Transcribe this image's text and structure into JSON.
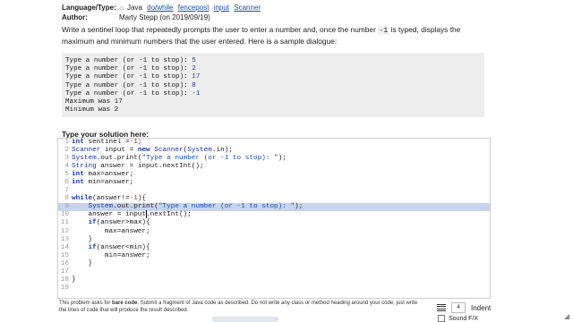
{
  "meta": {
    "language_label": "Language/Type:",
    "language_icon": "java-cup-icon",
    "language_value": "Java",
    "tags": [
      "do/while",
      "fencepost",
      "input",
      "Scanner"
    ],
    "author_label": "Author:",
    "author_value": "Marty Stepp (on 2019/09/19)"
  },
  "description": {
    "before_code": "Write a sentinel loop that repeatedly prompts the user to enter a number and, once the number ",
    "code": "-1",
    "after_code": " is typed, displays the maximum and minimum numbers that the user entered. Here is a sample dialogue:"
  },
  "sample": {
    "lines": [
      {
        "prompt": "Type a number (or -1 to stop): ",
        "input": "5"
      },
      {
        "prompt": "Type a number (or -1 to stop): ",
        "input": "2"
      },
      {
        "prompt": "Type a number (or -1 to stop): ",
        "input": "17"
      },
      {
        "prompt": "Type a number (or -1 to stop): ",
        "input": "8"
      },
      {
        "prompt": "Type a number (or -1 to stop): ",
        "input": "-1"
      }
    ],
    "output": [
      "Maximum was 17",
      "Minimum was 2"
    ]
  },
  "solution_label": "Type your solution here:",
  "editor": {
    "lines": [
      "int sentinel =-1;",
      "Scanner input = new Scanner(System.in);",
      "System.out.print(\"Type a number (or -1 to stop): \");",
      "String answer = input.nextInt();",
      "int max=answer;",
      "int min=answer;",
      "",
      "while(answer!=-1){",
      "    System.out.print(\"Type a number (or -1 to stop): \");",
      "    answer = input.nextInt();",
      "    if(answer>max){",
      "        max=answer;",
      "    }",
      "    if(answer<min){",
      "        min=answer;",
      "    }",
      "",
      "}",
      ""
    ]
  },
  "note": {
    "prefix": "This problem asks for ",
    "bold": "bare code",
    "suffix": ". Submit a fragment of Java code as described. Do not write any class or method heading around your code; just write the lines of code that will produce the result described."
  },
  "controls": {
    "indent_value": "4",
    "indent_label": "Indent",
    "sound_label": "Sound F/X"
  }
}
